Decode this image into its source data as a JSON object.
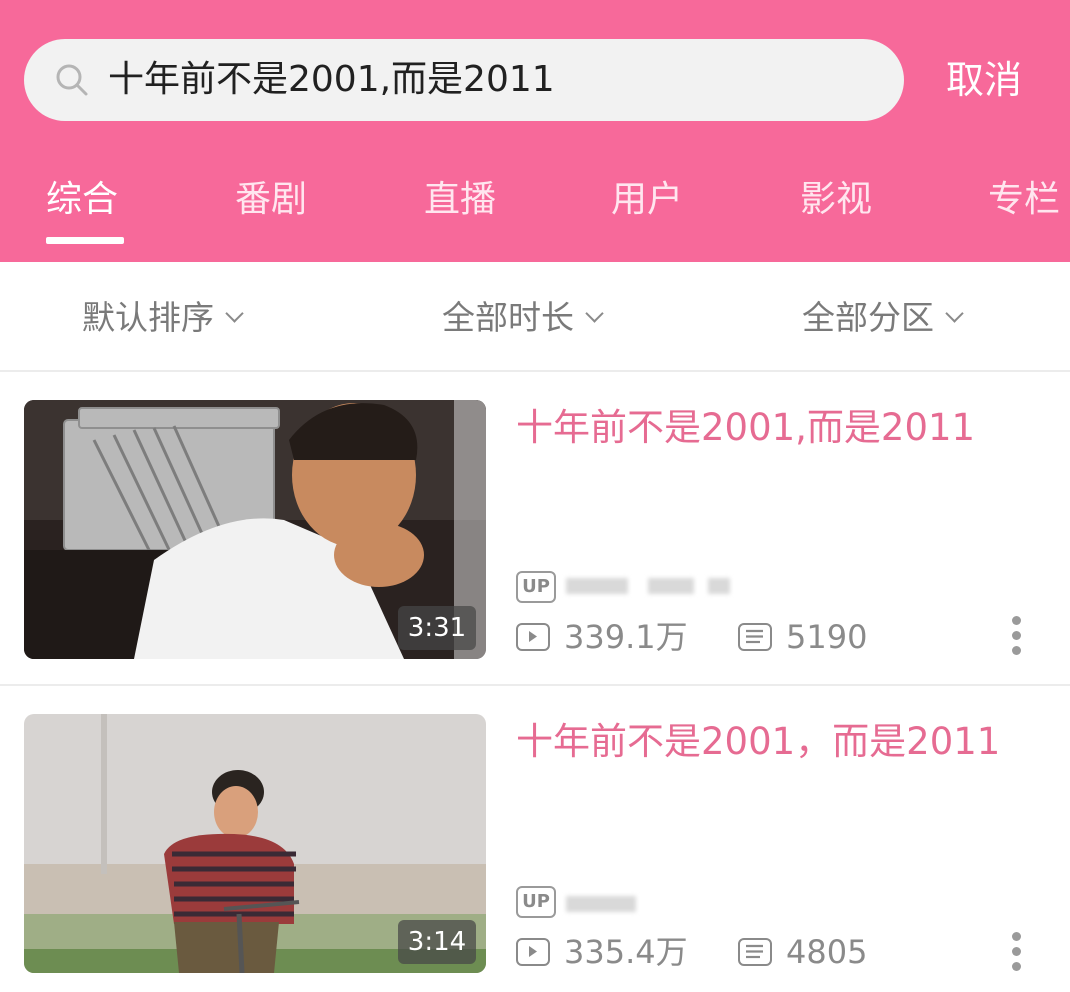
{
  "search": {
    "query": "十年前不是2001,而是2011",
    "cancel_label": "取消"
  },
  "tabs": [
    {
      "label": "综合"
    },
    {
      "label": "番剧"
    },
    {
      "label": "直播"
    },
    {
      "label": "用户"
    },
    {
      "label": "影视"
    },
    {
      "label": "专栏"
    }
  ],
  "filters": [
    {
      "label": "默认排序"
    },
    {
      "label": "全部时长"
    },
    {
      "label": "全部分区"
    }
  ],
  "results": [
    {
      "title": "十年前不是2001,而是2011",
      "duration": "3:31",
      "up_badge": "UP",
      "views": "339.1万",
      "danmaku": "5190"
    },
    {
      "title": "十年前不是2001，而是2011",
      "duration": "3:14",
      "up_badge": "UP",
      "views": "335.4万",
      "danmaku": "4805"
    }
  ],
  "colors": {
    "brand_pink": "#f7699a",
    "title_pink": "#e66b92"
  }
}
